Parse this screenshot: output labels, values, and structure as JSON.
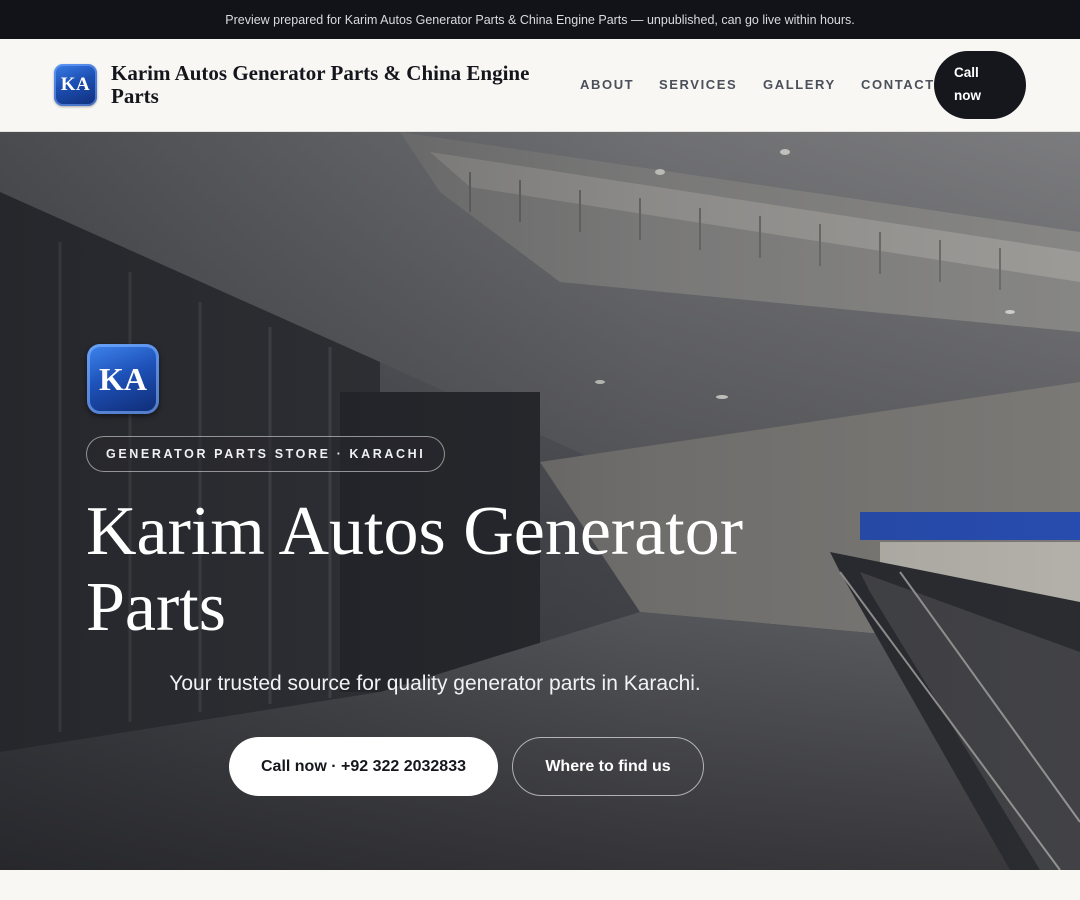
{
  "banner": {
    "text": "Preview prepared for Karim Autos Generator Parts & China Engine Parts — unpublished, can go live within hours."
  },
  "header": {
    "logo_initials": "KA",
    "brand_name": "Karim Autos Generator Parts & China Engine Parts",
    "nav": [
      {
        "label": "ABOUT"
      },
      {
        "label": "SERVICES"
      },
      {
        "label": "GALLERY"
      },
      {
        "label": "CONTACT"
      }
    ],
    "call_button": {
      "line1": "Call",
      "line2": "now"
    }
  },
  "hero": {
    "logo_initials": "KA",
    "tag": "GENERATOR PARTS STORE · KARACHI",
    "title": "Karim Autos Generator Parts",
    "subtitle": "Your trusted source for quality generator parts in Karachi.",
    "primary_button": "Call now · +92 322 2032833",
    "secondary_button": "Where to find us"
  },
  "colors": {
    "banner_bg": "#111318",
    "header_bg": "#f8f7f4",
    "dark_button": "#15171d",
    "logo_blue": "#1d4fb3"
  }
}
